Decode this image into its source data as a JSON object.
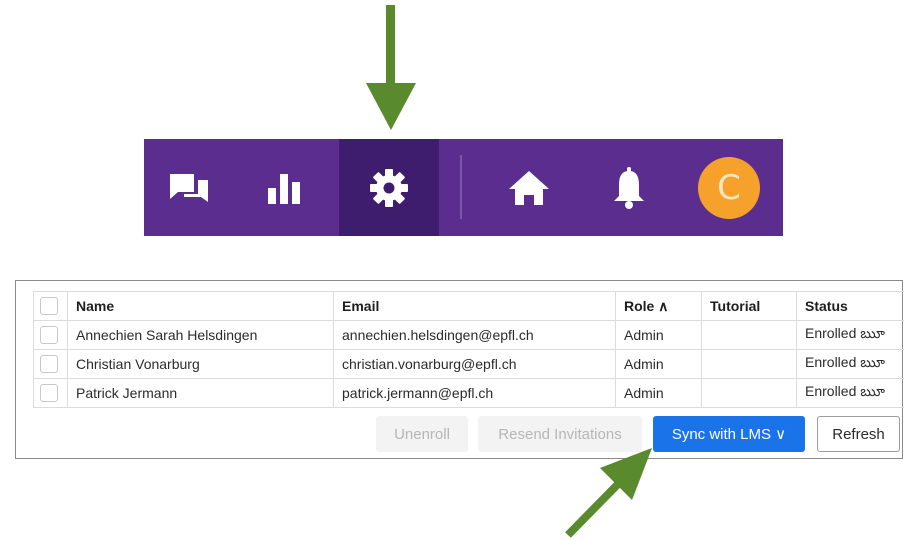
{
  "icons": {
    "discussion": "discussion-icon",
    "stats": "bar-chart-icon",
    "settings": "gear-icon",
    "home": "home-icon",
    "notifications": "bell-icon"
  },
  "colors": {
    "nav_bg": "#5b2d8e",
    "nav_active": "#3e1c6e",
    "avatar": "#f6a12b",
    "primary": "#1a73e8",
    "arrow": "#5a8a2e"
  },
  "avatar": {
    "initial": "C"
  },
  "table": {
    "headers": {
      "name": "Name",
      "email": "Email",
      "role": "Role ∧",
      "tutorial": "Tutorial",
      "status": "Status"
    },
    "rows": [
      {
        "name": "Annechien Sarah Helsdingen",
        "email": "annechien.helsdingen@epfl.ch",
        "role": "Admin",
        "tutorial": "",
        "status": "Enrolled ౠ"
      },
      {
        "name": "Christian Vonarburg",
        "email": "christian.vonarburg@epfl.ch",
        "role": "Admin",
        "tutorial": "",
        "status": "Enrolled ౠ"
      },
      {
        "name": "Patrick Jermann",
        "email": "patrick.jermann@epfl.ch",
        "role": "Admin",
        "tutorial": "",
        "status": "Enrolled ౠ"
      }
    ]
  },
  "actions": {
    "unenroll": "Unenroll",
    "resend": "Resend Invitations",
    "sync": "Sync with LMS ∨",
    "refresh": "Refresh"
  }
}
